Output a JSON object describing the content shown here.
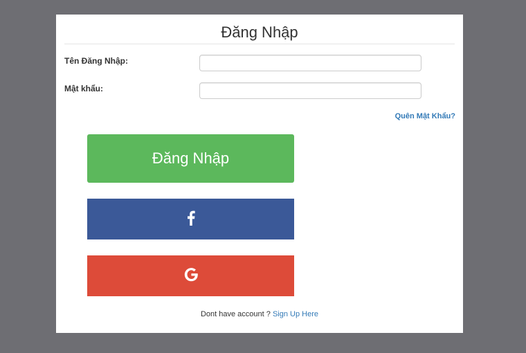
{
  "modal": {
    "title": "Đăng Nhập"
  },
  "form": {
    "username_label": "Tên Đăng Nhập:",
    "username_value": "",
    "password_label": "Mật khẩu:",
    "password_value": "",
    "forgot_password_label": "Quên Mật Khẩu?"
  },
  "buttons": {
    "login_label": "Đăng Nhập",
    "facebook_icon": "facebook-icon",
    "google_icon": "google-icon"
  },
  "signup": {
    "prompt": "Dont have account ?",
    "link_label": "Sign Up Here"
  },
  "colors": {
    "login_green": "#5cb85c",
    "facebook_blue": "#3b5998",
    "google_red": "#dd4b39",
    "link_blue": "#337ab7",
    "backdrop": "#6e6e73"
  }
}
